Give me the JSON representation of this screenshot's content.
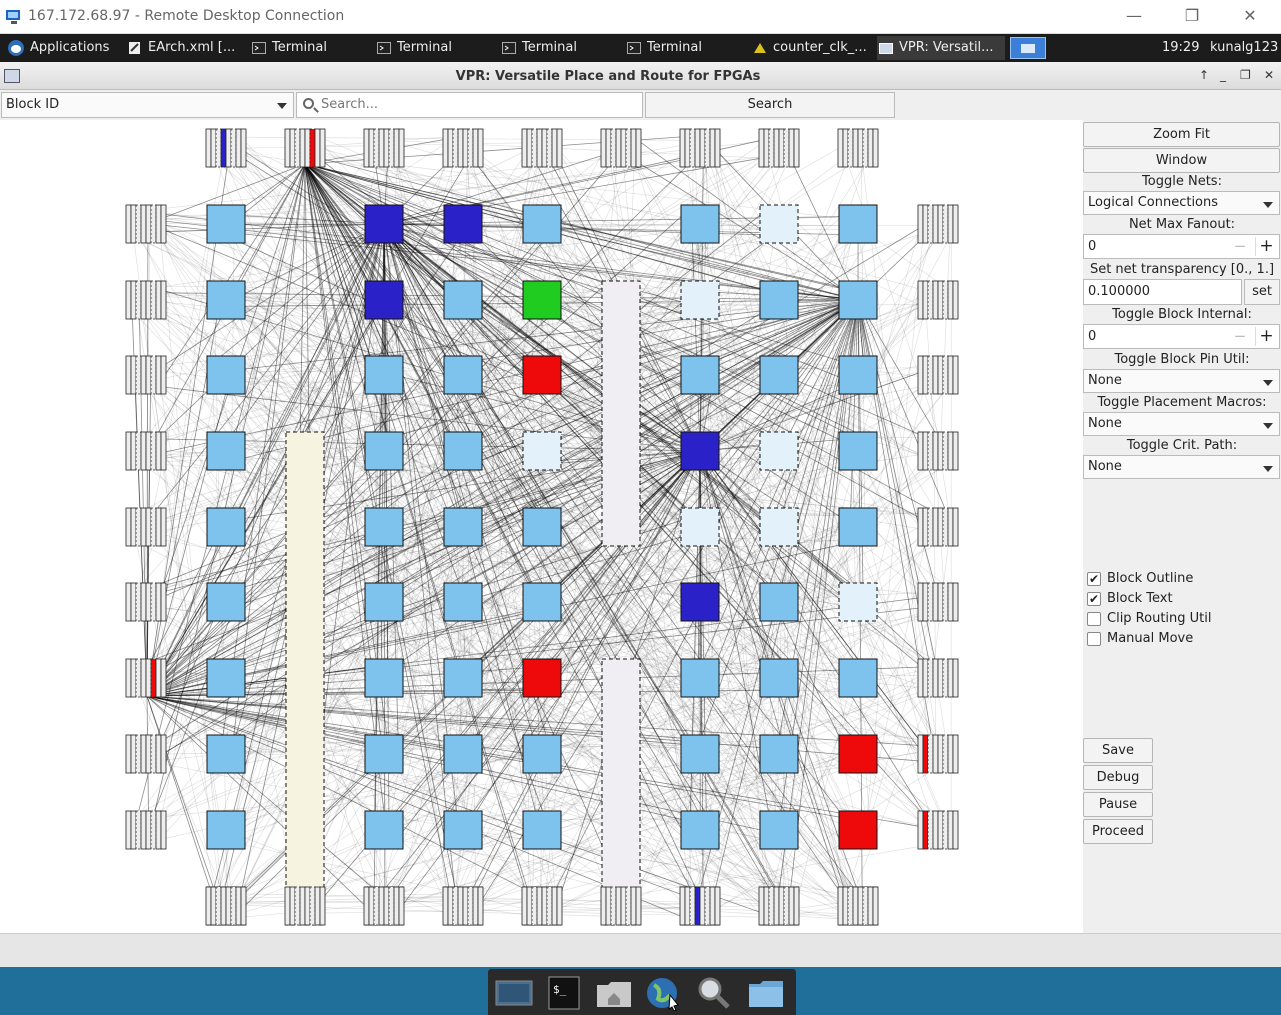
{
  "rdp": {
    "title": "167.172.68.97 - Remote Desktop Connection",
    "minimize": "—",
    "maximize": "❐",
    "close": "✕"
  },
  "taskbar": {
    "apps_label": "Applications",
    "items": [
      {
        "label": "EArch.xml [..."
      },
      {
        "label": "Terminal"
      },
      {
        "label": "Terminal"
      },
      {
        "label": "Terminal"
      },
      {
        "label": "Terminal"
      },
      {
        "label": "counter_clk_..."
      },
      {
        "label": "VPR: Versatil..."
      }
    ],
    "clock": "19:29",
    "user": "kunalg123"
  },
  "window": {
    "title": "VPR: Versatile Place and Route for FPGAs",
    "controls": [
      "↑",
      "_",
      "❐",
      "✕"
    ]
  },
  "toolbar": {
    "block_select": "Block ID",
    "search_placeholder": "Search...",
    "search_button": "Search"
  },
  "panel": {
    "zoom_fit": "Zoom Fit",
    "window_btn": "Window",
    "toggle_nets_label": "Toggle Nets:",
    "toggle_nets_value": "Logical Connections",
    "net_max_fanout_label": "Net Max Fanout:",
    "net_max_fanout_value": "0",
    "net_transparency_label": "Set net transparency [0., 1.]",
    "net_transparency_value": "0.100000",
    "set_button": "set",
    "toggle_block_internal_label": "Toggle Block Internal:",
    "toggle_block_internal_value": "0",
    "toggle_pin_util_label": "Toggle Block Pin Util:",
    "toggle_pin_util_value": "None",
    "toggle_macros_label": "Toggle Placement Macros:",
    "toggle_macros_value": "None",
    "toggle_crit_label": "Toggle Crit. Path:",
    "toggle_crit_value": "None",
    "checkboxes": [
      {
        "label": "Block Outline",
        "checked": true
      },
      {
        "label": "Block Text",
        "checked": true
      },
      {
        "label": "Clip Routing Util",
        "checked": false
      },
      {
        "label": "Manual Move",
        "checked": false
      }
    ],
    "save": "Save",
    "debug": "Debug",
    "pause": "Pause",
    "proceed": "Proceed"
  },
  "colors": {
    "clb": "#7ec3ee",
    "clb_empty": "#e3f1fb",
    "clb_blue": "#2a22c8",
    "clb_green": "#1fcc1f",
    "clb_red": "#ee0a0a",
    "mem": "#f6f4e0",
    "mult": "#f1eef3",
    "net": "#000000"
  },
  "fpga_grid": {
    "io_columns": [
      "...,..",
      "...",
      "..."
    ],
    "note_rows": 10
  },
  "dock": {
    "items": [
      "desktop-icon",
      "terminal-icon",
      "home-folder-icon",
      "browser-icon",
      "search-app-icon",
      "folder-icon"
    ]
  }
}
